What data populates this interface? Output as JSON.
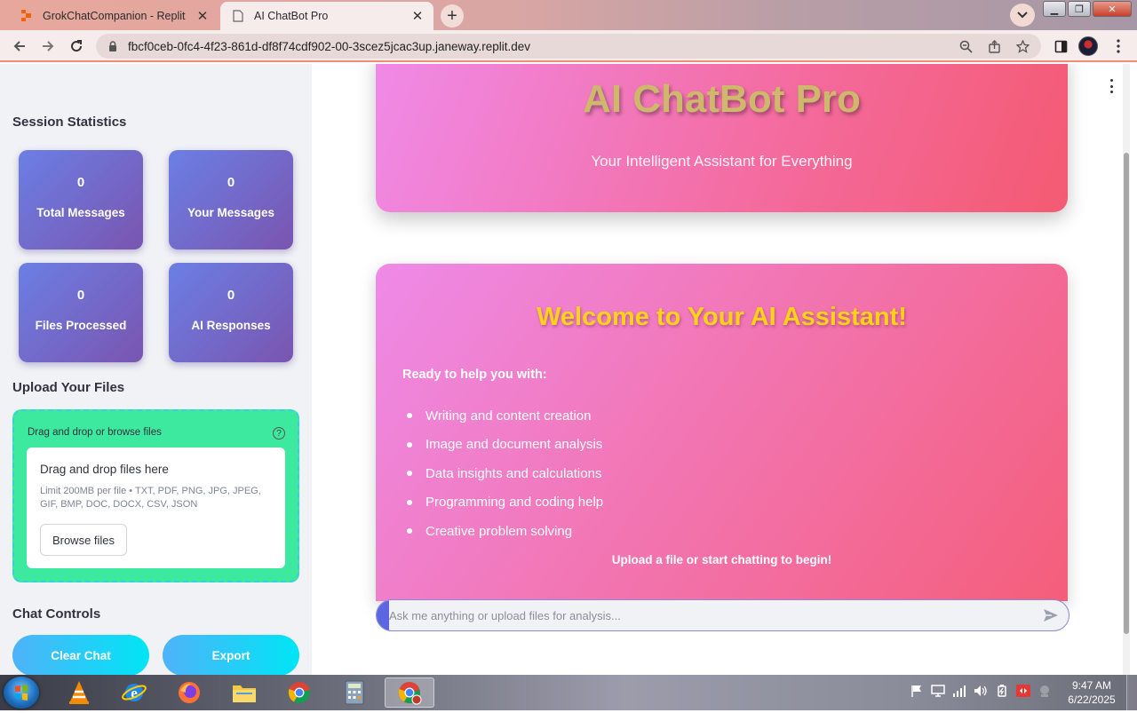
{
  "browser": {
    "tabs": [
      {
        "title": "GrokChatCompanion - Replit",
        "active": false,
        "favicon": "replit-icon"
      },
      {
        "title": "AI ChatBot Pro",
        "active": true,
        "favicon": "page-icon"
      }
    ],
    "url": "fbcf0ceb-0fc4-4f23-861d-df8f74cdf902-00-3scez5jcac3up.janeway.replit.dev"
  },
  "sidebar": {
    "session_heading": "Session Statistics",
    "stats": [
      {
        "value": "0",
        "label": "Total Messages"
      },
      {
        "value": "0",
        "label": "Your Messages"
      },
      {
        "value": "0",
        "label": "Files Processed"
      },
      {
        "value": "0",
        "label": "AI Responses"
      }
    ],
    "upload_heading": "Upload Your Files",
    "uploader": {
      "label": "Drag and drop or browse files",
      "drop_title": "Drag and drop files here",
      "limit_text": "Limit 200MB per file • TXT, PDF, PNG, JPG, JPEG, GIF, BMP, DOC, DOCX, CSV, JSON",
      "browse_label": "Browse files"
    },
    "controls_heading": "Chat Controls",
    "controls": {
      "clear_label": "Clear Chat",
      "export_label": "Export"
    }
  },
  "main": {
    "hero": {
      "title": "AI ChatBot Pro",
      "subtitle": "Your Intelligent Assistant for Everything"
    },
    "welcome": {
      "title": "Welcome to Your AI Assistant!",
      "intro": "Ready to help you with:",
      "items": [
        "Writing and content creation",
        "Image and document analysis",
        "Data insights and calculations",
        "Programming and coding help",
        "Creative problem solving"
      ],
      "footer": "Upload a file or start chatting to begin!"
    },
    "chat_input": {
      "placeholder": "Ask me anything or upload files for analysis..."
    }
  },
  "taskbar": {
    "apps": [
      "vlc-icon",
      "internet-explorer-icon",
      "firefox-icon",
      "file-explorer-icon",
      "chrome-icon",
      "calculator-icon",
      "chrome-icon"
    ],
    "clock": {
      "time": "9:47 AM",
      "date": "6/22/2025"
    }
  },
  "colors": {
    "stat_card": "#6b7fe4",
    "hero_gradient_start": "#f08ae8",
    "hero_gradient_end": "#f45a72",
    "welcome_title": "#ffd21a",
    "uploader_bg": "#3ce99e",
    "control_button": "#00e5f6"
  }
}
